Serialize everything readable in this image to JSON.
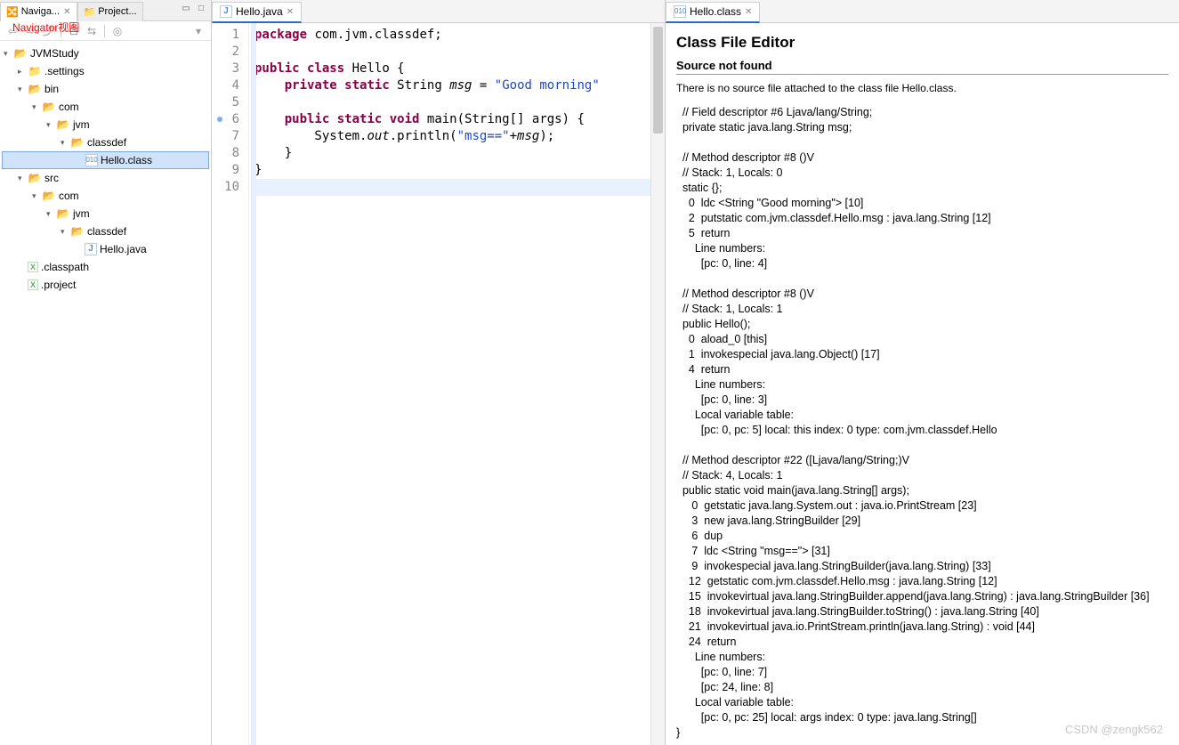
{
  "left": {
    "tabs": [
      {
        "label": "Naviga...",
        "active": true
      },
      {
        "label": "Project...",
        "active": false
      }
    ],
    "annotation": "Navigator视图",
    "tree": [
      {
        "depth": 0,
        "type": "project",
        "label": "JVMStudy",
        "expand": "open"
      },
      {
        "depth": 1,
        "type": "folder-closed",
        "label": ".settings",
        "expand": "closed"
      },
      {
        "depth": 1,
        "type": "folder-open",
        "label": "bin",
        "expand": "open"
      },
      {
        "depth": 2,
        "type": "folder-open",
        "label": "com",
        "expand": "open"
      },
      {
        "depth": 3,
        "type": "folder-open",
        "label": "jvm",
        "expand": "open"
      },
      {
        "depth": 4,
        "type": "folder-open",
        "label": "classdef",
        "expand": "open"
      },
      {
        "depth": 5,
        "type": "class",
        "label": "Hello.class",
        "selected": true
      },
      {
        "depth": 1,
        "type": "folder-open",
        "label": "src",
        "expand": "open"
      },
      {
        "depth": 2,
        "type": "folder-open",
        "label": "com",
        "expand": "open"
      },
      {
        "depth": 3,
        "type": "folder-open",
        "label": "jvm",
        "expand": "open"
      },
      {
        "depth": 4,
        "type": "folder-open",
        "label": "classdef",
        "expand": "open"
      },
      {
        "depth": 5,
        "type": "java",
        "label": "Hello.java"
      },
      {
        "depth": 1,
        "type": "xfile",
        "label": ".classpath"
      },
      {
        "depth": 1,
        "type": "xfile",
        "label": ".project"
      }
    ]
  },
  "editor": {
    "tab_label": "Hello.java",
    "lines": [
      {
        "n": 1,
        "html": "<span class='kw'>package</span> com.jvm.classdef;"
      },
      {
        "n": 2,
        "html": ""
      },
      {
        "n": 3,
        "html": "<span class='kw'>public</span> <span class='kw'>class</span> Hello {"
      },
      {
        "n": 4,
        "html": "    <span class='kw'>private</span> <span class='kw'>static</span> String <span class='it'>msg</span> = <span class='str'>\"Good morning\"</span>"
      },
      {
        "n": 5,
        "html": ""
      },
      {
        "n": 6,
        "html": "    <span class='kw'>public</span> <span class='kw'>static</span> <span class='kw'>void</span> main(String[] args) {",
        "marker": true
      },
      {
        "n": 7,
        "html": "        System.<span class='it'>out</span>.println(<span class='str'>\"msg==\"</span>+<span class='it'>msg</span>);"
      },
      {
        "n": 8,
        "html": "    }"
      },
      {
        "n": 9,
        "html": "}"
      },
      {
        "n": 10,
        "html": "",
        "cursor": true
      }
    ]
  },
  "classview": {
    "tab_label": "Hello.class",
    "title": "Class File Editor",
    "subtitle": "Source not found",
    "note": "There is no source file attached to the class file Hello.class.",
    "body": "  // Field descriptor #6 Ljava/lang/String;\n  private static java.lang.String msg;\n  \n  // Method descriptor #8 ()V\n  // Stack: 1, Locals: 0\n  static {};\n    0  ldc <String \"Good morning\"> [10]\n    2  putstatic com.jvm.classdef.Hello.msg : java.lang.String [12]\n    5  return\n      Line numbers:\n        [pc: 0, line: 4]\n  \n  // Method descriptor #8 ()V\n  // Stack: 1, Locals: 1\n  public Hello();\n    0  aload_0 [this]\n    1  invokespecial java.lang.Object() [17]\n    4  return\n      Line numbers:\n        [pc: 0, line: 3]\n      Local variable table:\n        [pc: 0, pc: 5] local: this index: 0 type: com.jvm.classdef.Hello\n  \n  // Method descriptor #22 ([Ljava/lang/String;)V\n  // Stack: 4, Locals: 1\n  public static void main(java.lang.String[] args);\n     0  getstatic java.lang.System.out : java.io.PrintStream [23]\n     3  new java.lang.StringBuilder [29]\n     6  dup\n     7  ldc <String \"msg==\"> [31]\n     9  invokespecial java.lang.StringBuilder(java.lang.String) [33]\n    12  getstatic com.jvm.classdef.Hello.msg : java.lang.String [12]\n    15  invokevirtual java.lang.StringBuilder.append(java.lang.String) : java.lang.StringBuilder [36]\n    18  invokevirtual java.lang.StringBuilder.toString() : java.lang.String [40]\n    21  invokevirtual java.io.PrintStream.println(java.lang.String) : void [44]\n    24  return\n      Line numbers:\n        [pc: 0, line: 7]\n        [pc: 24, line: 8]\n      Local variable table:\n        [pc: 0, pc: 25] local: args index: 0 type: java.lang.String[]\n}"
  },
  "watermark": "CSDN @zengk562"
}
